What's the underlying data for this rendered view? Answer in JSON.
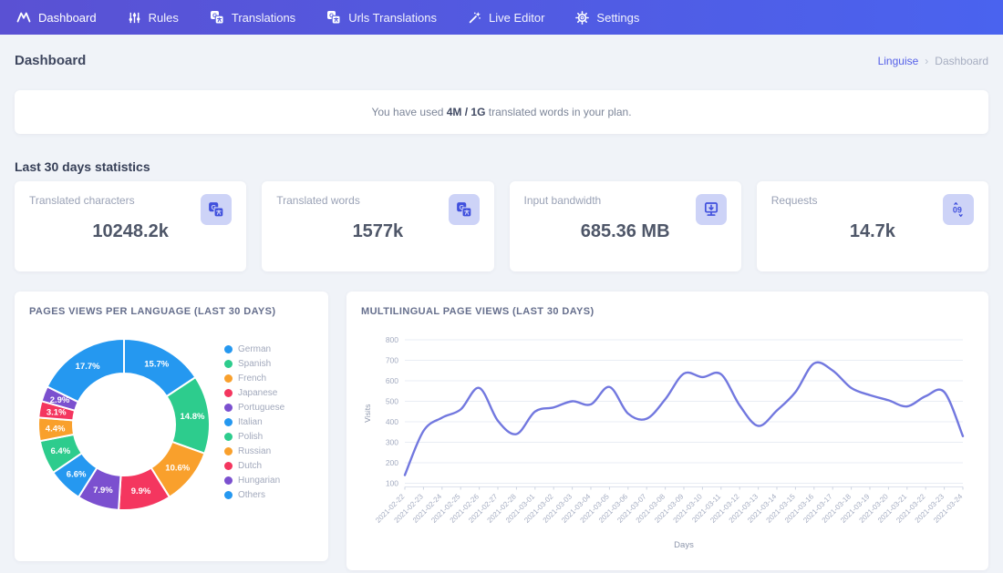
{
  "colors": {
    "navbar_gradient_start": "#5a51d3",
    "navbar_gradient_end": "#4a63ef",
    "page_bg": "#f0f3f8",
    "link": "#5560e8",
    "line_color": "#7278df",
    "icon_tile_bg": "#cdd3f7",
    "icon_tile_fg": "#4050dd"
  },
  "navbar": {
    "items": [
      {
        "label": "Dashboard",
        "icon": "linguise-logo-icon"
      },
      {
        "label": "Rules",
        "icon": "sliders-icon"
      },
      {
        "label": "Translations",
        "icon": "translate-icon"
      },
      {
        "label": "Urls Translations",
        "icon": "translate-icon"
      },
      {
        "label": "Live Editor",
        "icon": "wand-icon"
      },
      {
        "label": "Settings",
        "icon": "gear-icon"
      }
    ]
  },
  "header": {
    "title": "Dashboard",
    "breadcrumb": {
      "parent": "Linguise",
      "separator": "›",
      "current": "Dashboard"
    }
  },
  "notice": {
    "prefix": "You have used ",
    "usage": "4M / 1G",
    "suffix": " translated words in your plan."
  },
  "stats": {
    "section_title": "Last 30 days statistics",
    "cards": [
      {
        "label": "Translated characters",
        "value": "10248.2k",
        "icon": "translate-icon"
      },
      {
        "label": "Translated words",
        "value": "1577k",
        "icon": "translate-icon"
      },
      {
        "label": "Input bandwidth",
        "value": "685.36 MB",
        "icon": "bandwidth-icon"
      },
      {
        "label": "Requests",
        "value": "14.7k",
        "icon": "requests-icon"
      }
    ]
  },
  "chart_data": [
    {
      "type": "pie",
      "donut": true,
      "title": "PAGES VIEWS PER LANGUAGE (LAST 30 DAYS)",
      "labels": [
        "German",
        "Spanish",
        "French",
        "Japanese",
        "Portuguese",
        "Italian",
        "Polish",
        "Russian",
        "Dutch",
        "Hungarian",
        "Others"
      ],
      "values": [
        15.7,
        14.8,
        10.6,
        9.9,
        7.9,
        6.6,
        6.4,
        4.4,
        3.1,
        2.9,
        17.7
      ],
      "colors": [
        "#2598f0",
        "#2dcc8d",
        "#f9a02c",
        "#f4365f",
        "#7b50cf",
        "#2598f0",
        "#2dcc8d",
        "#f9a02c",
        "#f4365f",
        "#7b50cf",
        "#2598f0"
      ],
      "legend_position": "right",
      "label_format": "percent"
    },
    {
      "type": "line",
      "title": "MULTILINGUAL PAGE VIEWS (LAST 30 DAYS)",
      "xlabel": "Days",
      "ylabel": "Visits",
      "ylim": [
        100,
        800
      ],
      "yticks": [
        100,
        200,
        300,
        400,
        500,
        600,
        700,
        800
      ],
      "grid": true,
      "line_color": "#7278df",
      "x": [
        "2021-02-22",
        "2021-02-23",
        "2021-02-24",
        "2021-02-25",
        "2021-02-26",
        "2021-02-27",
        "2021-02-28",
        "2021-03-01",
        "2021-03-02",
        "2021-03-03",
        "2021-03-04",
        "2021-03-05",
        "2021-03-06",
        "2021-03-07",
        "2021-03-08",
        "2021-03-09",
        "2021-03-10",
        "2021-03-11",
        "2021-03-12",
        "2021-03-13",
        "2021-03-14",
        "2021-03-15",
        "2021-03-16",
        "2021-03-17",
        "2021-03-18",
        "2021-03-19",
        "2021-03-20",
        "2021-03-21",
        "2021-03-22",
        "2021-03-23",
        "2021-03-24"
      ],
      "values": [
        140,
        355,
        420,
        460,
        565,
        405,
        340,
        450,
        470,
        500,
        485,
        570,
        440,
        415,
        510,
        635,
        618,
        632,
        480,
        380,
        455,
        545,
        685,
        650,
        565,
        530,
        505,
        475,
        525,
        545,
        330
      ]
    }
  ]
}
